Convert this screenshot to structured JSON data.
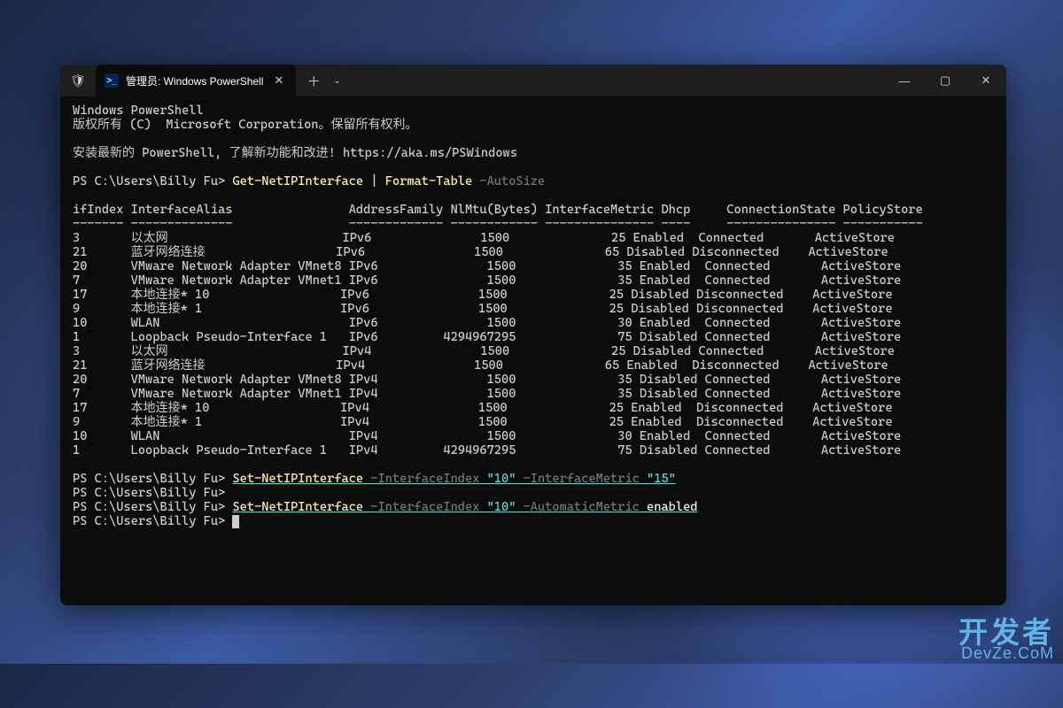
{
  "window": {
    "title": "管理员: Windows PowerShell"
  },
  "banner": {
    "line1": "Windows PowerShell",
    "line2": "版权所有 (C)  Microsoft Corporation。保留所有权利。",
    "line3_pre": "安装最新的 PowerShell, 了解新功能和改进! ",
    "line3_url": "https://aka.ms/PSWindows"
  },
  "prompt": "PS C:\\Users\\Billy Fu> ",
  "cmd1": {
    "c1": "Get-NetIPInterface",
    "pipe": " | ",
    "c2": "Format-Table",
    "arg": " -AutoSize"
  },
  "header_row": "ifIndex InterfaceAlias                AddressFamily NlMtu(Bytes) InterfaceMetric Dhcp     ConnectionState PolicyStore",
  "header_dash": "------- --------------                ------------- ------------ --------------- ----     --------------- -----------",
  "table": [
    {
      "idx": "3",
      "alias": "以太网",
      "fam": "IPv6",
      "mtu": "1500",
      "metric": "25",
      "dhcp": "Enabled",
      "conn": "Connected",
      "store": "ActiveStore"
    },
    {
      "idx": "21",
      "alias": "蓝牙网络连接",
      "fam": "IPv6",
      "mtu": "1500",
      "metric": "65",
      "dhcp": "Disabled",
      "conn": "Disconnected",
      "store": "ActiveStore"
    },
    {
      "idx": "20",
      "alias": "VMware Network Adapter VMnet8",
      "fam": "IPv6",
      "mtu": "1500",
      "metric": "35",
      "dhcp": "Enabled",
      "conn": "Connected",
      "store": "ActiveStore"
    },
    {
      "idx": "7",
      "alias": "VMware Network Adapter VMnet1",
      "fam": "IPv6",
      "mtu": "1500",
      "metric": "35",
      "dhcp": "Enabled",
      "conn": "Connected",
      "store": "ActiveStore"
    },
    {
      "idx": "17",
      "alias": "本地连接* 10",
      "fam": "IPv6",
      "mtu": "1500",
      "metric": "25",
      "dhcp": "Disabled",
      "conn": "Disconnected",
      "store": "ActiveStore"
    },
    {
      "idx": "9",
      "alias": "本地连接* 1",
      "fam": "IPv6",
      "mtu": "1500",
      "metric": "25",
      "dhcp": "Disabled",
      "conn": "Disconnected",
      "store": "ActiveStore"
    },
    {
      "idx": "10",
      "alias": "WLAN",
      "fam": "IPv6",
      "mtu": "1500",
      "metric": "30",
      "dhcp": "Enabled",
      "conn": "Connected",
      "store": "ActiveStore"
    },
    {
      "idx": "1",
      "alias": "Loopback Pseudo-Interface 1",
      "fam": "IPv6",
      "mtu": "4294967295",
      "metric": "75",
      "dhcp": "Disabled",
      "conn": "Connected",
      "store": "ActiveStore"
    },
    {
      "idx": "3",
      "alias": "以太网",
      "fam": "IPv4",
      "mtu": "1500",
      "metric": "25",
      "dhcp": "Disabled",
      "conn": "Connected",
      "store": "ActiveStore"
    },
    {
      "idx": "21",
      "alias": "蓝牙网络连接",
      "fam": "IPv4",
      "mtu": "1500",
      "metric": "65",
      "dhcp": "Enabled",
      "conn": "Disconnected",
      "store": "ActiveStore"
    },
    {
      "idx": "20",
      "alias": "VMware Network Adapter VMnet8",
      "fam": "IPv4",
      "mtu": "1500",
      "metric": "35",
      "dhcp": "Disabled",
      "conn": "Connected",
      "store": "ActiveStore"
    },
    {
      "idx": "7",
      "alias": "VMware Network Adapter VMnet1",
      "fam": "IPv4",
      "mtu": "1500",
      "metric": "35",
      "dhcp": "Disabled",
      "conn": "Connected",
      "store": "ActiveStore"
    },
    {
      "idx": "17",
      "alias": "本地连接* 10",
      "fam": "IPv4",
      "mtu": "1500",
      "metric": "25",
      "dhcp": "Enabled",
      "conn": "Disconnected",
      "store": "ActiveStore"
    },
    {
      "idx": "9",
      "alias": "本地连接* 1",
      "fam": "IPv4",
      "mtu": "1500",
      "metric": "25",
      "dhcp": "Enabled",
      "conn": "Disconnected",
      "store": "ActiveStore"
    },
    {
      "idx": "10",
      "alias": "WLAN",
      "fam": "IPv4",
      "mtu": "1500",
      "metric": "30",
      "dhcp": "Enabled",
      "conn": "Connected",
      "store": "ActiveStore"
    },
    {
      "idx": "1",
      "alias": "Loopback Pseudo-Interface 1",
      "fam": "IPv4",
      "mtu": "4294967295",
      "metric": "75",
      "dhcp": "Disabled",
      "conn": "Connected",
      "store": "ActiveStore"
    }
  ],
  "cmd2": {
    "c": "Set-NetIPInterface",
    "a1": " -InterfaceIndex",
    "v1": " \"10\"",
    "a2": " -InterfaceMetric",
    "v2": " \"15\""
  },
  "cmd3": {
    "c": "Set-NetIPInterface",
    "a1": " -InterfaceIndex",
    "v1": " \"10\"",
    "a2": " -AutomaticMetric",
    "v2": " enabled"
  },
  "watermark": {
    "top": "开发者",
    "bottom": "DevZe.CoM"
  },
  "ps_icon_glyph": ">_",
  "shield_glyph": "🛡"
}
